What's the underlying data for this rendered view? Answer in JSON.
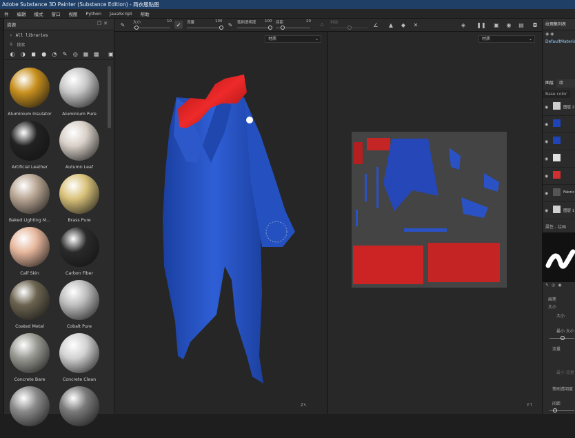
{
  "window": {
    "title": "Adobe Substance 3D Painter (Substance Edition) - 两衣服贴图"
  },
  "menu": [
    "件",
    "编辑",
    "模式",
    "窗口",
    "视图",
    "Python",
    "JavaScript",
    "帮助"
  ],
  "toolbar": {
    "size_label": "大小",
    "size_value": "10",
    "flow_label": "流量",
    "flow_value": "100",
    "opacity_label": "笔刷透明度",
    "opacity_value": "100",
    "spacing_label": "间距",
    "spacing_value": "20",
    "angle_label": "抖动",
    "size_fraction": 0.1,
    "flow_fraction": 1.0,
    "opacity_fraction": 1.0,
    "spacing_fraction": 0.2
  },
  "assets": {
    "title": "资源",
    "library": "All libraries",
    "search_placeholder": "搜索",
    "items": [
      {
        "label": "Aluminium Insulator",
        "color": "#c8901e"
      },
      {
        "label": "Aluminium Pure",
        "color": "#c8c8c8"
      },
      {
        "label": "Artificial Leather",
        "color": "#222222"
      },
      {
        "label": "Autumn Leaf",
        "color": "#d8d0c8"
      },
      {
        "label": "Baked Lighting M...",
        "color": "#b9a694"
      },
      {
        "label": "Brass Pure",
        "color": "#d9c27a"
      },
      {
        "label": "Calf Skin",
        "color": "#e6b79c"
      },
      {
        "label": "Carbon Fiber",
        "color": "#2a2a2a"
      },
      {
        "label": "Coated Metal",
        "color": "#6b6350"
      },
      {
        "label": "Cobalt Pure",
        "color": "#bdbdbd"
      },
      {
        "label": "Concrete Bare",
        "color": "#9a9a94"
      },
      {
        "label": "Concrete Clean",
        "color": "#d2d2d2"
      },
      {
        "label": "",
        "color": "#8a8a8a"
      },
      {
        "label": "",
        "color": "#7a7a7a"
      }
    ]
  },
  "viewport3d": {
    "dropdown": "材质"
  },
  "viewport2d": {
    "dropdown": "材质"
  },
  "right": {
    "texture_set_title": "纹理集列表",
    "texture_set_item": "DefaultMaterial",
    "tab_layers": "图层",
    "tab_second": "纹",
    "channel_select": "Base color",
    "layers": [
      {
        "name": "图层 2"
      },
      {
        "name": ""
      },
      {
        "name": ""
      },
      {
        "name": ""
      },
      {
        "name": ""
      },
      {
        "name": "Fabric"
      },
      {
        "name": "图层 1"
      }
    ],
    "props_title": "属性 - 绘画",
    "brush_section": "画笔",
    "size_label": "大小",
    "size_sub": "大小",
    "min_size": "最小 大小",
    "flow_label": "流量",
    "min_flow": "最小 流量",
    "opacity_label": "笔刷透明度",
    "spacing_label": "间距"
  }
}
